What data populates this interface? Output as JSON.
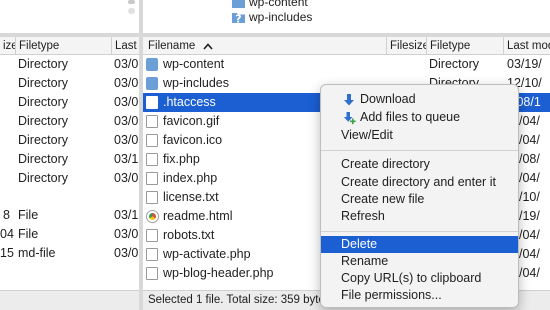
{
  "left_pane": {
    "columns": {
      "filesize": "ize",
      "filetype": "Filetype",
      "last": "Last"
    },
    "rows": [
      {
        "size": "",
        "type": "Directory",
        "date": "03/0"
      },
      {
        "size": "",
        "type": "Directory",
        "date": "03/0"
      },
      {
        "size": "",
        "type": "Directory",
        "date": "03/0"
      },
      {
        "size": "",
        "type": "Directory",
        "date": "03/0"
      },
      {
        "size": "",
        "type": "Directory",
        "date": "03/0"
      },
      {
        "size": "",
        "type": "Directory",
        "date": "03/1"
      },
      {
        "size": "",
        "type": "Directory",
        "date": "03/0"
      },
      {
        "size": "8",
        "type": "File",
        "date": "03/1"
      },
      {
        "size": "04",
        "type": "File",
        "date": "03/0"
      },
      {
        "size": "15",
        "type": "md-file",
        "date": "03/0"
      }
    ]
  },
  "right_tree": {
    "items": [
      {
        "label": "wp-content",
        "icon": "folder-icon"
      },
      {
        "label": "wp-includes",
        "icon": "unknown-folder-icon"
      }
    ]
  },
  "right_pane": {
    "columns": {
      "filename": "Filename",
      "sort_indicator": "^",
      "filesize": "Filesize",
      "filetype": "Filetype",
      "last": "Last mod"
    },
    "rows": [
      {
        "name": "wp-content",
        "type": "Directory",
        "date": "03/19/",
        "icon": "folder"
      },
      {
        "name": "wp-includes",
        "type": "Directory",
        "date": "12/10/",
        "icon": "folder"
      },
      {
        "name": ".htaccess",
        "type": "",
        "date": "/08/1",
        "icon": "doc",
        "selected": true
      },
      {
        "name": "favicon.gif",
        "type": "",
        "date": "/04/",
        "icon": "doc"
      },
      {
        "name": "favicon.ico",
        "type": "",
        "date": "/04/",
        "icon": "doc"
      },
      {
        "name": "fix.php",
        "type": "",
        "date": "/08/",
        "icon": "doc"
      },
      {
        "name": "index.php",
        "type": "",
        "date": "/04/",
        "icon": "doc"
      },
      {
        "name": "license.txt",
        "type": "",
        "date": "/10/",
        "icon": "doc"
      },
      {
        "name": "readme.html",
        "type": "",
        "date": "/19/",
        "icon": "chrome"
      },
      {
        "name": "robots.txt",
        "type": "",
        "date": "/04/",
        "icon": "doc"
      },
      {
        "name": "wp-activate.php",
        "type": "",
        "date": "/04/",
        "icon": "doc"
      },
      {
        "name": "wp-blog-header.php",
        "type": "",
        "date": "/04/",
        "icon": "doc"
      }
    ]
  },
  "status_bar": {
    "text": "Selected 1 file. Total size: 359 byte"
  },
  "context_menu": {
    "download": "Download",
    "add_to_queue": "Add files to queue",
    "view_edit": "View/Edit",
    "create_directory": "Create directory",
    "create_directory_enter": "Create directory and enter it",
    "create_new_file": "Create new file",
    "refresh": "Refresh",
    "delete": "Delete",
    "rename": "Rename",
    "copy_url": "Copy URL(s) to clipboard",
    "file_permissions": "File permissions..."
  },
  "colors": {
    "selection": "#1b5fd3",
    "folder": "#6c9fd6",
    "download_icon": "#2f6fcf",
    "queue_icon": "#3aa04a"
  }
}
